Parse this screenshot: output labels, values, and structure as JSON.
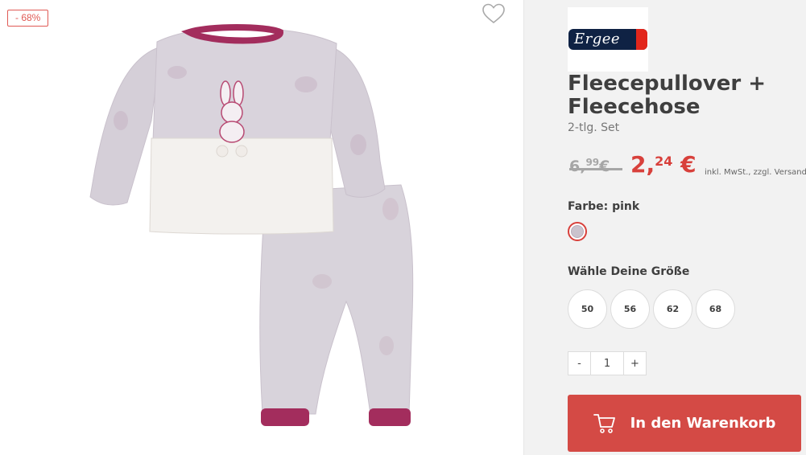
{
  "badge": {
    "discount": "- 68%"
  },
  "product": {
    "brand": "Ergee",
    "title": "Fleecepullover + Fleecehose",
    "subtitle": "2-tlg. Set"
  },
  "price": {
    "old_main": "6,",
    "old_cents": "99",
    "old_currency": "€",
    "new_main": "2,",
    "new_cents": "24",
    "new_currency": "€",
    "vat_note": "inkl. MwSt., zzgl. Versandkosten"
  },
  "color": {
    "label": "Farbe: pink",
    "swatch_hex": "#cbc3cd",
    "selected_border": "#d8403b"
  },
  "size": {
    "label": "Wähle Deine Größe",
    "options": [
      "50",
      "56",
      "62",
      "68"
    ]
  },
  "quantity": {
    "minus": "-",
    "value": "1",
    "plus": "+"
  },
  "cart": {
    "label": "In den Warenkorb",
    "color": "#d44a45"
  },
  "icons": {
    "wishlist": "heart-icon",
    "cart": "shopping-cart-icon"
  }
}
